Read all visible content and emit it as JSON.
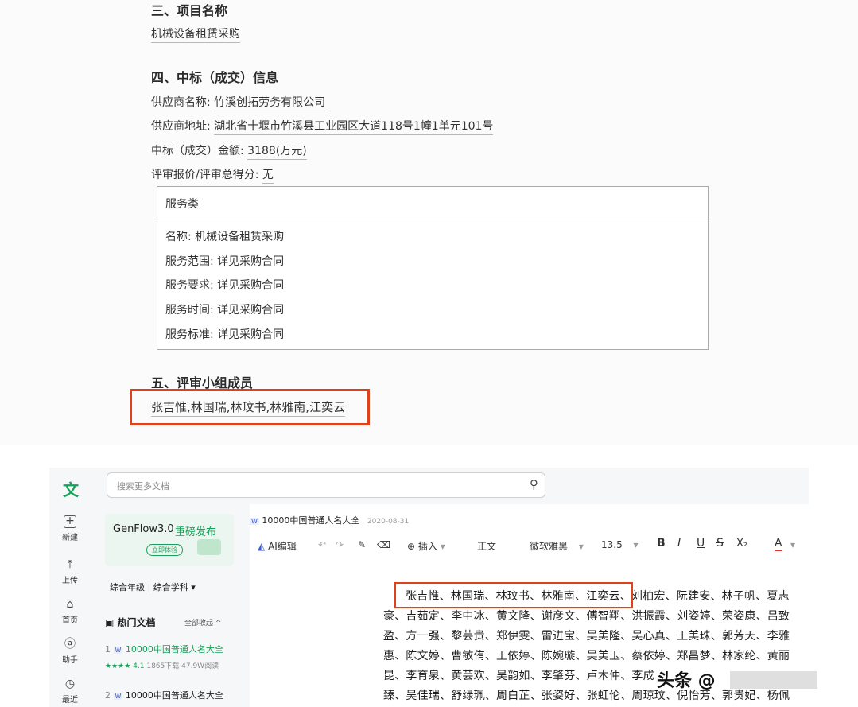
{
  "document": {
    "section3": {
      "heading": "三、项目名称",
      "value": "机械设备租赁采购"
    },
    "section4": {
      "heading": "四、中标（成交）信息",
      "supplier_name_label": "供应商名称:",
      "supplier_name": "竹溪创拓劳务有限公司",
      "supplier_address_label": "供应商地址:",
      "supplier_address": "湖北省十堰市竹溪县工业园区大道118号1幢1单元101号",
      "amount_label": "中标（成交）金额:",
      "amount": "3188(万元)",
      "score_label": "评审报价/评审总得分:",
      "score": "无",
      "service_box": {
        "title": "服务类",
        "rows": [
          "名称: 机械设备租赁采购",
          "服务范围: 详见采购合同",
          "服务要求: 详见采购合同",
          "服务时间: 详见采购合同",
          "服务标准: 详见采购合同"
        ]
      }
    },
    "section5": {
      "heading": "五、评审小组成员",
      "members": "张吉惟,林国瑞,林玟书,林雅南,江奕云"
    },
    "highlight_color": "#e0411b"
  },
  "app": {
    "logo": "文",
    "rail": [
      {
        "label": "新建",
        "icon": "plus-icon"
      },
      {
        "label": "上传",
        "icon": "upload-icon"
      },
      {
        "label": "首页",
        "icon": "home-icon"
      },
      {
        "label": "助手",
        "icon": "assistant-icon"
      },
      {
        "label": "最近",
        "icon": "clock-icon"
      }
    ],
    "search_placeholder": "搜索更多文档",
    "banner": {
      "title": "GenFlow3.0",
      "highlight": "重磅发布",
      "button": "立即体验"
    },
    "filters": {
      "grade": "综合年级",
      "subject": "综合学科"
    },
    "hot_docs": {
      "title": "热门文档",
      "collapse": "全部收起",
      "items": [
        {
          "index": "1",
          "title": "10000中国普通人名大全",
          "stars": "★★★★",
          "rating": "4.1",
          "downloads": "1865下载",
          "reads": "47.9W阅读"
        },
        {
          "index": "2",
          "title": "10000中国普通人名大全"
        }
      ]
    },
    "doc_header": {
      "title": "10000中国普通人名大全",
      "date": "2020-08-31"
    },
    "toolbar": {
      "ai_edit": "AI编辑",
      "insert": "插入",
      "style": "正文",
      "font": "微软雅黑",
      "size": "13.5",
      "bold": "B",
      "italic": "I",
      "underline": "U",
      "strike": "S",
      "subscript": "X₂",
      "font_color": "A"
    },
    "names_lines": [
      "张吉惟、林国瑞、林玟书、林雅南、江奕云、刘柏宏、阮建安、林子帆、夏志",
      "豪、吉茹定、李中冰、黄文隆、谢彦文、傅智翔、洪振霞、刘姿婷、荣姿康、吕致",
      "盈、方一强、黎芸贵、郑伊雯、雷进宝、吴美隆、吴心真、王美珠、郭芳天、李雅",
      "惠、陈文婷、曹敏侑、王依婷、陈婉璇、吴美玉、蔡依婷、郑昌梦、林家纶、黄丽",
      "昆、李育泉、黄芸欢、吴韵如、李肇芬、卢木仲、李成",
      "臻、吴佳瑞、舒绿珮、周白芷、张姿好、张虹伦、周琼玟、倪怡芳、郭贵妃、杨佩"
    ],
    "watermark": "头条 @"
  }
}
